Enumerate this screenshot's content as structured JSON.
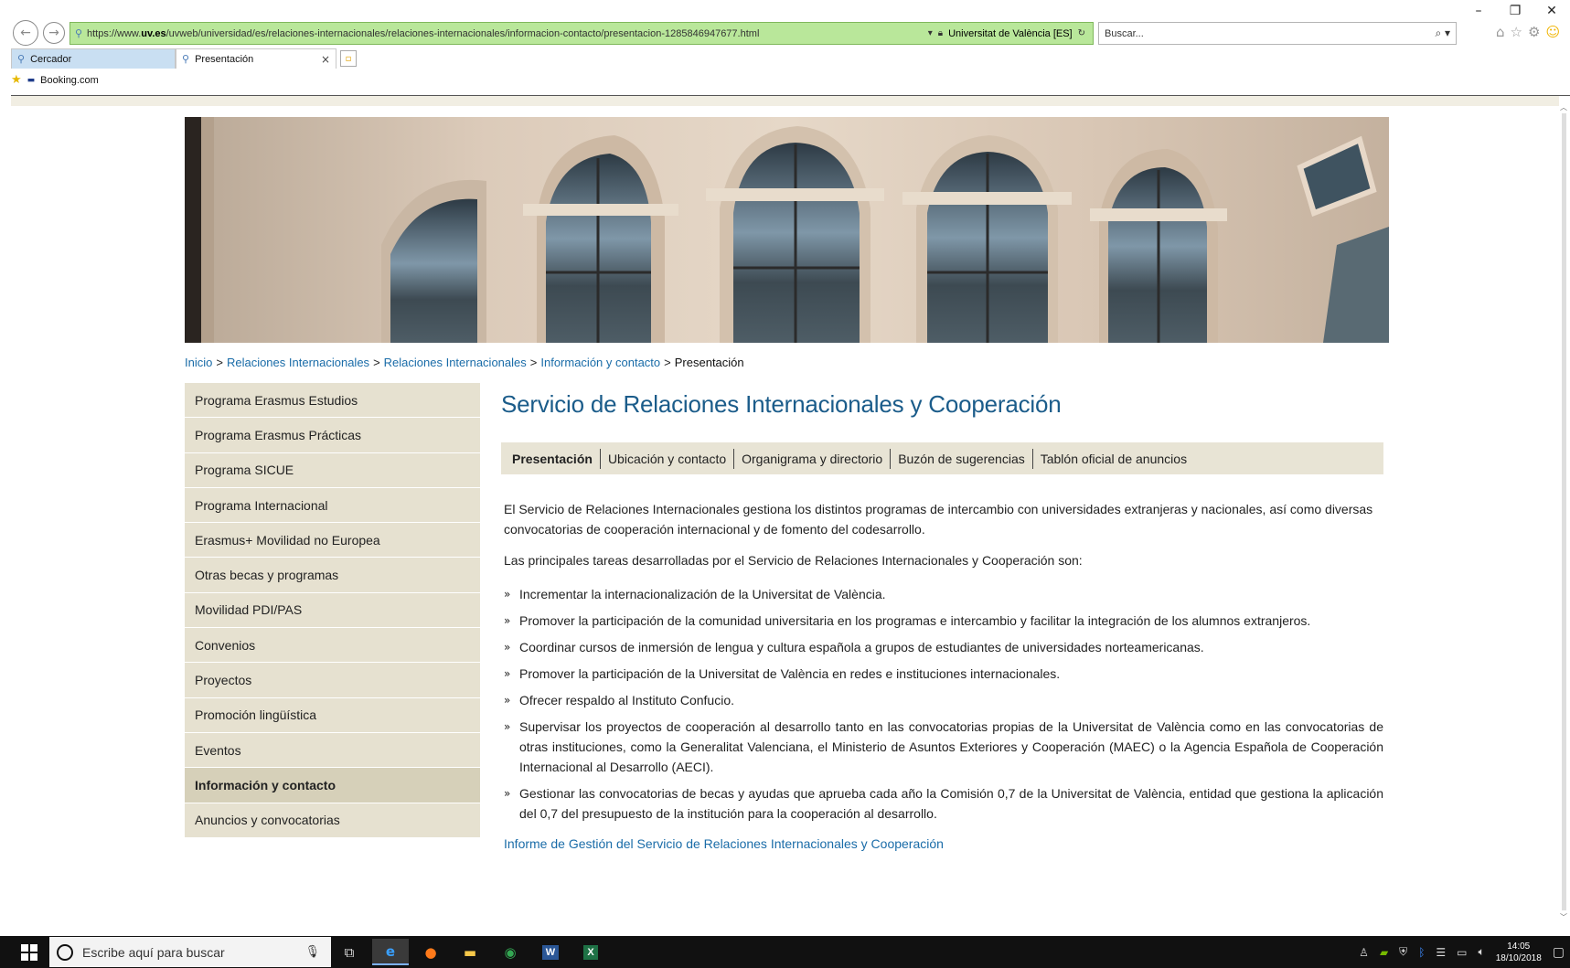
{
  "browser": {
    "url_prefix": "https://www.",
    "url_host": "uv.es",
    "url_path": "/uvweb/universidad/es/relaciones-internacionales/relaciones-internacionales/informacion-contacto/presentacion-1285846947677.html",
    "site_identity": "Universitat de València [ES]",
    "search_placeholder": "Buscar...",
    "tabs": [
      {
        "label": "Cercador"
      },
      {
        "label": "Presentación"
      }
    ],
    "favorites": [
      "Booking.com"
    ]
  },
  "breadcrumb": {
    "items": [
      "Inicio",
      "Relaciones Internacionales",
      "Relaciones Internacionales",
      "Información y contacto"
    ],
    "current": "Presentación",
    "separator": ">"
  },
  "sidemenu": {
    "items": [
      {
        "label": "Programa Erasmus Estudios",
        "active": false
      },
      {
        "label": "Programa Erasmus Prácticas",
        "active": false
      },
      {
        "label": "Programa SICUE",
        "active": false
      },
      {
        "label": "Programa Internacional",
        "active": false
      },
      {
        "label": "Erasmus+ Movilidad no Europea",
        "active": false
      },
      {
        "label": "Otras becas y programas",
        "active": false
      },
      {
        "label": "Movilidad PDI/PAS",
        "active": false
      },
      {
        "label": "Convenios",
        "active": false
      },
      {
        "label": "Proyectos",
        "active": false
      },
      {
        "label": "Promoción lingüística",
        "active": false
      },
      {
        "label": "Eventos",
        "active": false
      },
      {
        "label": "Información y contacto",
        "active": true
      },
      {
        "label": "Anuncios y convocatorias",
        "active": false
      }
    ]
  },
  "main": {
    "title": "Servicio de Relaciones Internacionales y Cooperación",
    "subtabs": [
      {
        "label": "Presentación",
        "active": true
      },
      {
        "label": "Ubicación y contacto",
        "active": false
      },
      {
        "label": "Organigrama y directorio",
        "active": false
      },
      {
        "label": "Buzón de sugerencias",
        "active": false
      },
      {
        "label": "Tablón oficial de anuncios",
        "active": false
      }
    ],
    "intro": "El Servicio de Relaciones Internacionales gestiona los distintos programas de intercambio con universidades extranjeras y nacionales, así como diversas convocatorias de cooperación internacional y de fomento del codesarrollo.",
    "lead": "Las principales tareas desarrolladas por el Servicio de Relaciones Internacionales y Cooperación son:",
    "bullet": "»",
    "tasks": [
      "Incrementar la internacionalización de la Universitat de València.",
      "Promover la participación de la comunidad universitaria en los programas e intercambio y facilitar la integración de los alumnos extranjeros.",
      "Coordinar cursos de inmersión de lengua y cultura española a grupos de estudiantes de universidades norteamericanas.",
      "Promover la participación de la Universitat de València en redes e instituciones internacionales.",
      "Ofrecer respaldo al Instituto Confucio.",
      "Supervisar los proyectos de cooperación al desarrollo tanto en las convocatorias propias de la Universitat de València como en las convocatorias de otras instituciones, como la Generalitat Valenciana, el Ministerio de Asuntos Exteriores y Cooperación (MAEC) o la Agencia Española de Cooperación Internacional al Desarrollo (AECI).",
      "Gestionar las convocatorias de becas y ayudas que aprueba cada año la Comisión 0,7 de la Universitat de València, entidad que gestiona la aplicación del 0,7 del presupuesto de la institución para la cooperación al desarrollo."
    ],
    "report_link": "Informe de Gestión del Servicio de Relaciones Internacionales y Cooperación"
  },
  "taskbar": {
    "search_placeholder": "Escribe aquí para buscar",
    "apps": [
      "task-view",
      "internet-explorer",
      "firefox",
      "file-explorer",
      "chrome",
      "word",
      "excel"
    ],
    "time": "14:05",
    "date": "18/10/2018"
  },
  "colors": {
    "accent_blue": "#1b5c8a",
    "link_blue": "#1a6ca8",
    "menu_bg": "#e6e1d0",
    "menu_active_bg": "#d6d0b9",
    "address_bar_green": "#b9e79a"
  }
}
